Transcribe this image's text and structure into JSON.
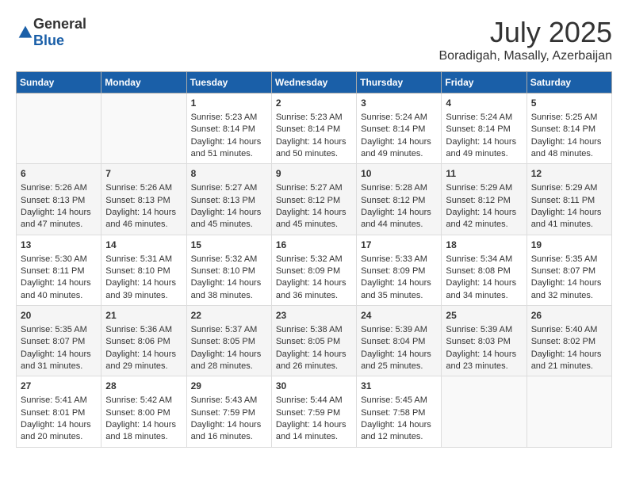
{
  "header": {
    "logo_general": "General",
    "logo_blue": "Blue",
    "month": "July 2025",
    "location": "Boradigah, Masally, Azerbaijan"
  },
  "weekdays": [
    "Sunday",
    "Monday",
    "Tuesday",
    "Wednesday",
    "Thursday",
    "Friday",
    "Saturday"
  ],
  "weeks": [
    [
      {
        "day": "",
        "sunrise": "",
        "sunset": "",
        "daylight": ""
      },
      {
        "day": "",
        "sunrise": "",
        "sunset": "",
        "daylight": ""
      },
      {
        "day": "1",
        "sunrise": "Sunrise: 5:23 AM",
        "sunset": "Sunset: 8:14 PM",
        "daylight": "Daylight: 14 hours and 51 minutes."
      },
      {
        "day": "2",
        "sunrise": "Sunrise: 5:23 AM",
        "sunset": "Sunset: 8:14 PM",
        "daylight": "Daylight: 14 hours and 50 minutes."
      },
      {
        "day": "3",
        "sunrise": "Sunrise: 5:24 AM",
        "sunset": "Sunset: 8:14 PM",
        "daylight": "Daylight: 14 hours and 49 minutes."
      },
      {
        "day": "4",
        "sunrise": "Sunrise: 5:24 AM",
        "sunset": "Sunset: 8:14 PM",
        "daylight": "Daylight: 14 hours and 49 minutes."
      },
      {
        "day": "5",
        "sunrise": "Sunrise: 5:25 AM",
        "sunset": "Sunset: 8:14 PM",
        "daylight": "Daylight: 14 hours and 48 minutes."
      }
    ],
    [
      {
        "day": "6",
        "sunrise": "Sunrise: 5:26 AM",
        "sunset": "Sunset: 8:13 PM",
        "daylight": "Daylight: 14 hours and 47 minutes."
      },
      {
        "day": "7",
        "sunrise": "Sunrise: 5:26 AM",
        "sunset": "Sunset: 8:13 PM",
        "daylight": "Daylight: 14 hours and 46 minutes."
      },
      {
        "day": "8",
        "sunrise": "Sunrise: 5:27 AM",
        "sunset": "Sunset: 8:13 PM",
        "daylight": "Daylight: 14 hours and 45 minutes."
      },
      {
        "day": "9",
        "sunrise": "Sunrise: 5:27 AM",
        "sunset": "Sunset: 8:12 PM",
        "daylight": "Daylight: 14 hours and 45 minutes."
      },
      {
        "day": "10",
        "sunrise": "Sunrise: 5:28 AM",
        "sunset": "Sunset: 8:12 PM",
        "daylight": "Daylight: 14 hours and 44 minutes."
      },
      {
        "day": "11",
        "sunrise": "Sunrise: 5:29 AM",
        "sunset": "Sunset: 8:12 PM",
        "daylight": "Daylight: 14 hours and 42 minutes."
      },
      {
        "day": "12",
        "sunrise": "Sunrise: 5:29 AM",
        "sunset": "Sunset: 8:11 PM",
        "daylight": "Daylight: 14 hours and 41 minutes."
      }
    ],
    [
      {
        "day": "13",
        "sunrise": "Sunrise: 5:30 AM",
        "sunset": "Sunset: 8:11 PM",
        "daylight": "Daylight: 14 hours and 40 minutes."
      },
      {
        "day": "14",
        "sunrise": "Sunrise: 5:31 AM",
        "sunset": "Sunset: 8:10 PM",
        "daylight": "Daylight: 14 hours and 39 minutes."
      },
      {
        "day": "15",
        "sunrise": "Sunrise: 5:32 AM",
        "sunset": "Sunset: 8:10 PM",
        "daylight": "Daylight: 14 hours and 38 minutes."
      },
      {
        "day": "16",
        "sunrise": "Sunrise: 5:32 AM",
        "sunset": "Sunset: 8:09 PM",
        "daylight": "Daylight: 14 hours and 36 minutes."
      },
      {
        "day": "17",
        "sunrise": "Sunrise: 5:33 AM",
        "sunset": "Sunset: 8:09 PM",
        "daylight": "Daylight: 14 hours and 35 minutes."
      },
      {
        "day": "18",
        "sunrise": "Sunrise: 5:34 AM",
        "sunset": "Sunset: 8:08 PM",
        "daylight": "Daylight: 14 hours and 34 minutes."
      },
      {
        "day": "19",
        "sunrise": "Sunrise: 5:35 AM",
        "sunset": "Sunset: 8:07 PM",
        "daylight": "Daylight: 14 hours and 32 minutes."
      }
    ],
    [
      {
        "day": "20",
        "sunrise": "Sunrise: 5:35 AM",
        "sunset": "Sunset: 8:07 PM",
        "daylight": "Daylight: 14 hours and 31 minutes."
      },
      {
        "day": "21",
        "sunrise": "Sunrise: 5:36 AM",
        "sunset": "Sunset: 8:06 PM",
        "daylight": "Daylight: 14 hours and 29 minutes."
      },
      {
        "day": "22",
        "sunrise": "Sunrise: 5:37 AM",
        "sunset": "Sunset: 8:05 PM",
        "daylight": "Daylight: 14 hours and 28 minutes."
      },
      {
        "day": "23",
        "sunrise": "Sunrise: 5:38 AM",
        "sunset": "Sunset: 8:05 PM",
        "daylight": "Daylight: 14 hours and 26 minutes."
      },
      {
        "day": "24",
        "sunrise": "Sunrise: 5:39 AM",
        "sunset": "Sunset: 8:04 PM",
        "daylight": "Daylight: 14 hours and 25 minutes."
      },
      {
        "day": "25",
        "sunrise": "Sunrise: 5:39 AM",
        "sunset": "Sunset: 8:03 PM",
        "daylight": "Daylight: 14 hours and 23 minutes."
      },
      {
        "day": "26",
        "sunrise": "Sunrise: 5:40 AM",
        "sunset": "Sunset: 8:02 PM",
        "daylight": "Daylight: 14 hours and 21 minutes."
      }
    ],
    [
      {
        "day": "27",
        "sunrise": "Sunrise: 5:41 AM",
        "sunset": "Sunset: 8:01 PM",
        "daylight": "Daylight: 14 hours and 20 minutes."
      },
      {
        "day": "28",
        "sunrise": "Sunrise: 5:42 AM",
        "sunset": "Sunset: 8:00 PM",
        "daylight": "Daylight: 14 hours and 18 minutes."
      },
      {
        "day": "29",
        "sunrise": "Sunrise: 5:43 AM",
        "sunset": "Sunset: 7:59 PM",
        "daylight": "Daylight: 14 hours and 16 minutes."
      },
      {
        "day": "30",
        "sunrise": "Sunrise: 5:44 AM",
        "sunset": "Sunset: 7:59 PM",
        "daylight": "Daylight: 14 hours and 14 minutes."
      },
      {
        "day": "31",
        "sunrise": "Sunrise: 5:45 AM",
        "sunset": "Sunset: 7:58 PM",
        "daylight": "Daylight: 14 hours and 12 minutes."
      },
      {
        "day": "",
        "sunrise": "",
        "sunset": "",
        "daylight": ""
      },
      {
        "day": "",
        "sunrise": "",
        "sunset": "",
        "daylight": ""
      }
    ]
  ]
}
